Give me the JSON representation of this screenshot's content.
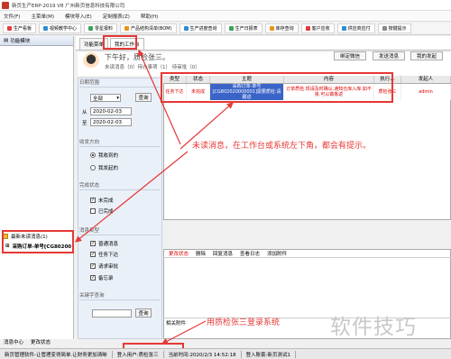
{
  "window": {
    "title": "新页生产ERP-2019 V8 广州新页信息科技有限公司"
  },
  "menu": [
    "文件(F)",
    "主菜单(M)",
    "模块导入(E)",
    "定制报表(Z)",
    "帮助(H)"
  ],
  "toolbar": [
    {
      "label": "生产看板",
      "color": "#e23c3c"
    },
    {
      "label": "视频教学中心",
      "color": "#2d8ed6"
    },
    {
      "label": "零星报料",
      "color": "#3aa45a"
    },
    {
      "label": "产品结构清单(BOM)",
      "color": "#e8941a"
    },
    {
      "label": "生产进度查询",
      "color": "#2d8ed6"
    },
    {
      "label": "生产日报表",
      "color": "#3aa45a"
    },
    {
      "label": "库存查询",
      "color": "#e8941a"
    },
    {
      "label": "客户应收",
      "color": "#e23c3c"
    },
    {
      "label": "供应商应付",
      "color": "#2d8ed6"
    },
    {
      "label": "按键提示",
      "color": "#888888"
    }
  ],
  "left": {
    "header": "功能模块",
    "notif_title": "最新未读消息(1)",
    "notif_item": "采购订单-单号[CG80200",
    "bottom_a": "消息中心",
    "bottom_b": "更改状态"
  },
  "tabs": {
    "a": "功能菜单",
    "b": "我的工作台"
  },
  "greeting": {
    "title": "下午好，质检张三。",
    "subtitle": "未读消息（0）待办事项（1） 待审批（0）"
  },
  "buttons": {
    "bind": "绑定微信",
    "send": "发送消息",
    "mine": "我的发起",
    "query": "查询"
  },
  "filters": {
    "date_title": "日期范围",
    "range": "全部",
    "from_label": "从",
    "from": "2020-02-03",
    "to_label": "至",
    "to": "2020-02-03",
    "dir_title": "收发方向",
    "recv": "我收到的",
    "sent": "我发起的",
    "done_title": "完成状态",
    "undone": "未完成",
    "done": "已完成",
    "type_title": "消息类型",
    "t1": "普通消息",
    "t2": "任务下达",
    "t3": "请求审批",
    "t4": "备忘录",
    "kw_title": "关键字查询"
  },
  "grid": {
    "headers": [
      "类型",
      "状态",
      "主题",
      "内容",
      "执行人",
      "发起人"
    ],
    "row": {
      "type": "任务下达",
      "status": "未完成",
      "subject": "采购订单-单号[CG802020000001]需要质检.请跟进",
      "content": "订单质检.现请及时确认.通知仓库入库.如不良.可以做拣返",
      "executor": "质检张三",
      "initiator": "admin"
    }
  },
  "detail": {
    "tabs": [
      "更改状态",
      "删除",
      "回复消息",
      "查看日志",
      "添加附件"
    ],
    "attach": "相关附件"
  },
  "status": {
    "s1": "新页管理软件-让管理变得简单.让财务更加清晰",
    "s2": "登入用户:质检张三",
    "s3": "当前时间:2020/2/3 14:52:18",
    "s4": "登入账套:新页测试1"
  },
  "annotations": {
    "a1": "未读消息，在工作台或系统左下角，都会有提示。",
    "a2": "用质检张三登录系统"
  },
  "watermark": "软件技巧"
}
